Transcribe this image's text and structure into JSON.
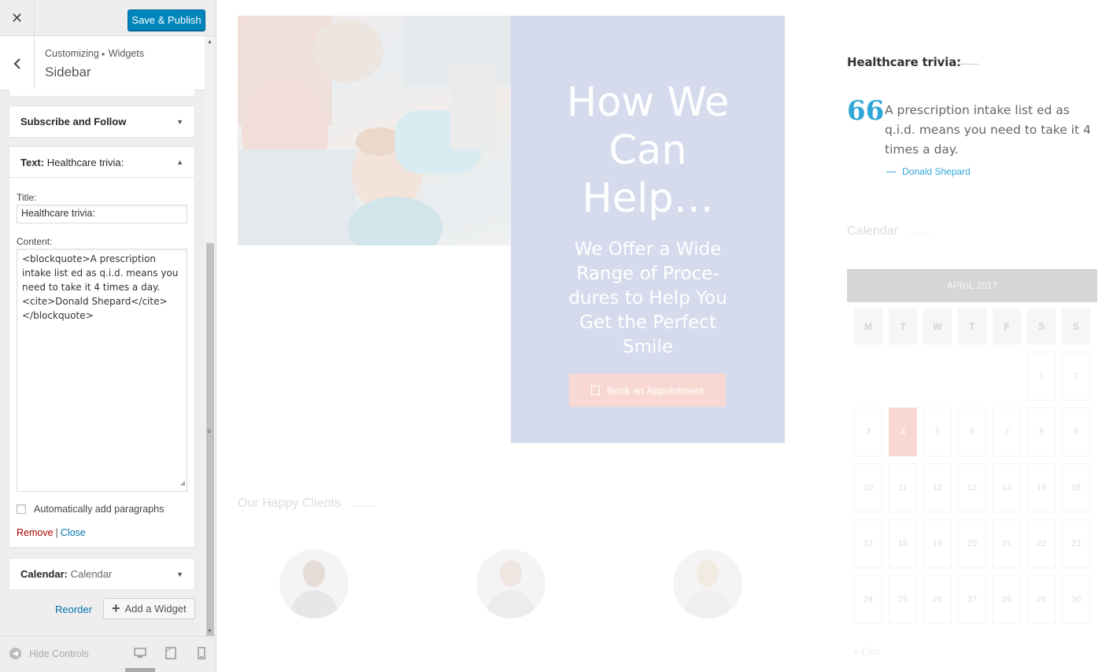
{
  "customizer": {
    "close_label": "✕",
    "save_label": "Save & Publish",
    "breadcrumb": {
      "root": "Customizing",
      "separator": "▸",
      "section": "Widgets"
    },
    "panel_title": "Sidebar",
    "widgets": [
      {
        "type_label": "",
        "name": "Subscribe and Follow",
        "expanded": false
      },
      {
        "type_label": "Text:",
        "name": "Healthcare trivia:",
        "expanded": true
      },
      {
        "type_label": "Calendar:",
        "name": "Calendar",
        "expanded": false
      }
    ],
    "text_widget": {
      "title_label": "Title:",
      "title_value": "Healthcare trivia:",
      "content_label": "Content:",
      "content_value": "<blockquote>A prescription intake list ed as q.i.d. means you need to take it 4 times a day.<cite>Donald Shepard</cite></blockquote>",
      "auto_paragraphs_label": "Automatically add paragraphs",
      "auto_paragraphs_checked": false,
      "remove_label": "Remove",
      "separator": "|",
      "close_label": "Close"
    },
    "reorder_label": "Reorder",
    "add_widget_label": "Add a Widget",
    "hide_controls_label": "Hide Controls",
    "devices": [
      "desktop-icon",
      "tablet-icon",
      "mobile-icon"
    ],
    "active_device": "desktop"
  },
  "preview": {
    "hero": {
      "title": "How We Can Help…",
      "subtitle": "We Offer a Wide Range of Proce-dures to Help You Get the Perfect Smile",
      "button_label": "Book an Appointment"
    },
    "clients_heading": "Our Happy Clients",
    "trivia": {
      "heading": "Healthcare trivia:",
      "quote_mark": "66",
      "quote": "A prescription intake list ed as q.i.d. means you need to take it 4 times a day.",
      "cite": "Donald Shepard"
    },
    "calendar": {
      "heading": "Calendar",
      "month": "APRIL 2017",
      "weekdays": [
        "M",
        "T",
        "W",
        "T",
        "F",
        "S",
        "S"
      ],
      "weeks": [
        [
          "",
          "",
          "",
          "",
          "",
          "1",
          "2"
        ],
        [
          "3",
          "4",
          "5",
          "6",
          "7",
          "8",
          "9"
        ],
        [
          "10",
          "11",
          "12",
          "13",
          "14",
          "15",
          "16"
        ],
        [
          "17",
          "18",
          "19",
          "20",
          "21",
          "22",
          "23"
        ],
        [
          "24",
          "25",
          "26",
          "27",
          "28",
          "29",
          "30"
        ]
      ],
      "today": "4",
      "prev_link": "« Dec"
    },
    "colors": {
      "accent_blue": "#30a7d6",
      "hero_box": "#d5dbec",
      "button_pink": "#f9d8d3",
      "save_button": "#0085ba"
    }
  }
}
